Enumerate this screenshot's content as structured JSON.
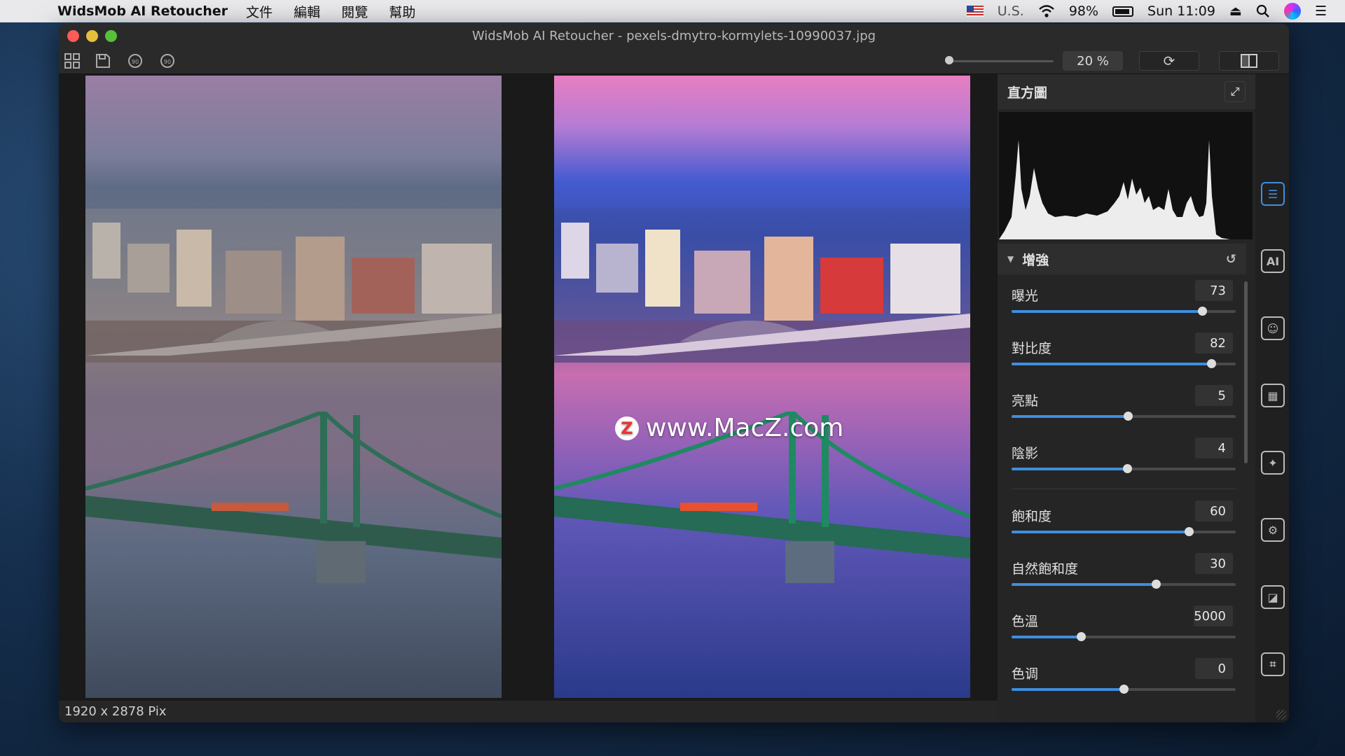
{
  "menubar": {
    "app_name": "WidsMob AI Retoucher",
    "menus": [
      "文件",
      "編輯",
      "閱覽",
      "幫助"
    ],
    "input_source": "U.S.",
    "battery": "98%",
    "clock": "Sun 11:09"
  },
  "window": {
    "title": "WidsMob AI Retoucher - pexels-dmytro-kormylets-10990037.jpg"
  },
  "toolbar": {
    "zoom_value": "20 %"
  },
  "watermark": {
    "logo": "Z",
    "text": "www.MacZ.com"
  },
  "status": {
    "dimensions": "1920 x 2878 Pix"
  },
  "panel": {
    "histogram_title": "直方圖",
    "section_title": "增強",
    "accent_color": "#3e8ee0",
    "sliders": [
      {
        "label": "曝光",
        "value": "73",
        "level": 0.85
      },
      {
        "label": "對比度",
        "value": "82",
        "level": 0.89
      },
      {
        "label": "亮點",
        "value": "5",
        "level": 0.52
      },
      {
        "label": "陰影",
        "value": "4",
        "level": 0.515
      },
      {
        "label": "飽和度",
        "value": "60",
        "level": 0.79
      },
      {
        "label": "自然飽和度",
        "value": "30",
        "level": 0.645
      },
      {
        "label": "色溫",
        "value": "5000",
        "level": 0.31
      },
      {
        "label": "色调",
        "value": "0",
        "level": 0.5
      }
    ]
  },
  "rail_icons": [
    "adjust-icon",
    "ai-icon",
    "portrait-icon",
    "noise-icon",
    "magic-icon",
    "settings-icon",
    "frame-icon",
    "crop-icon"
  ]
}
